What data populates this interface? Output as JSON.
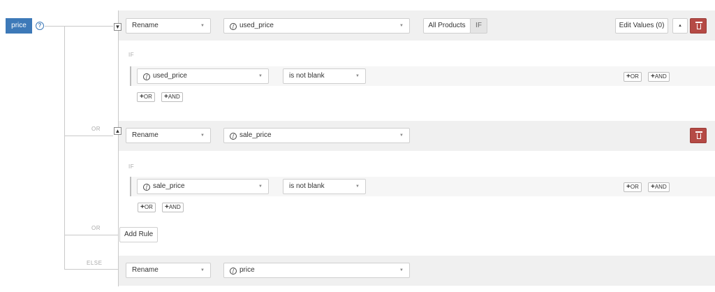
{
  "field": {
    "name": "price",
    "help_icon": "?"
  },
  "labels": {
    "or": "OR",
    "else": "ELSE",
    "if": "IF"
  },
  "toggles": {
    "collapse": "▼",
    "expand": "▲"
  },
  "caret": "▼",
  "fx_glyph": "f",
  "rules": [
    {
      "action": "Rename",
      "source": "used_price",
      "scope": "All Products",
      "if_label": "IF",
      "edit_values": "Edit Values (0)",
      "move_up": "▲",
      "conditions": [
        {
          "field": "used_price",
          "operator": "is not blank",
          "or_label": "OR",
          "and_label": "AND"
        }
      ],
      "add_or": "OR",
      "add_and": "AND"
    },
    {
      "action": "Rename",
      "source": "sale_price",
      "conditions": [
        {
          "field": "sale_price",
          "operator": "is not blank",
          "or_label": "OR",
          "and_label": "AND"
        }
      ],
      "add_or": "OR",
      "add_and": "AND"
    }
  ],
  "add_rule": "Add Rule",
  "else_rule": {
    "action": "Rename",
    "source": "price"
  }
}
